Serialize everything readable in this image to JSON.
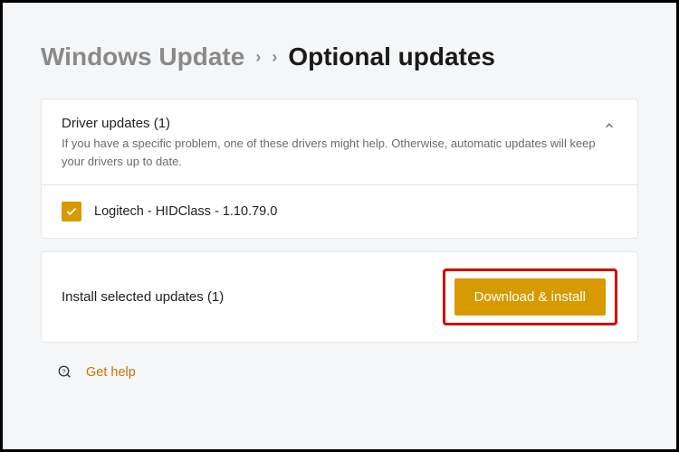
{
  "breadcrumb": {
    "root": "Windows Update",
    "current": "Optional updates"
  },
  "driver_section": {
    "title": "Driver updates (1)",
    "description": "If you have a specific problem, one of these drivers might help. Otherwise, automatic updates will keep your drivers up to date."
  },
  "drivers": [
    {
      "name": "Logitech - HIDClass - 1.10.79.0",
      "checked": true
    }
  ],
  "install_row": {
    "label": "Install selected updates (1)",
    "button": "Download & install"
  },
  "help": {
    "label": "Get help"
  },
  "colors": {
    "accent": "#d79a00",
    "highlight_box": "#d40000"
  }
}
